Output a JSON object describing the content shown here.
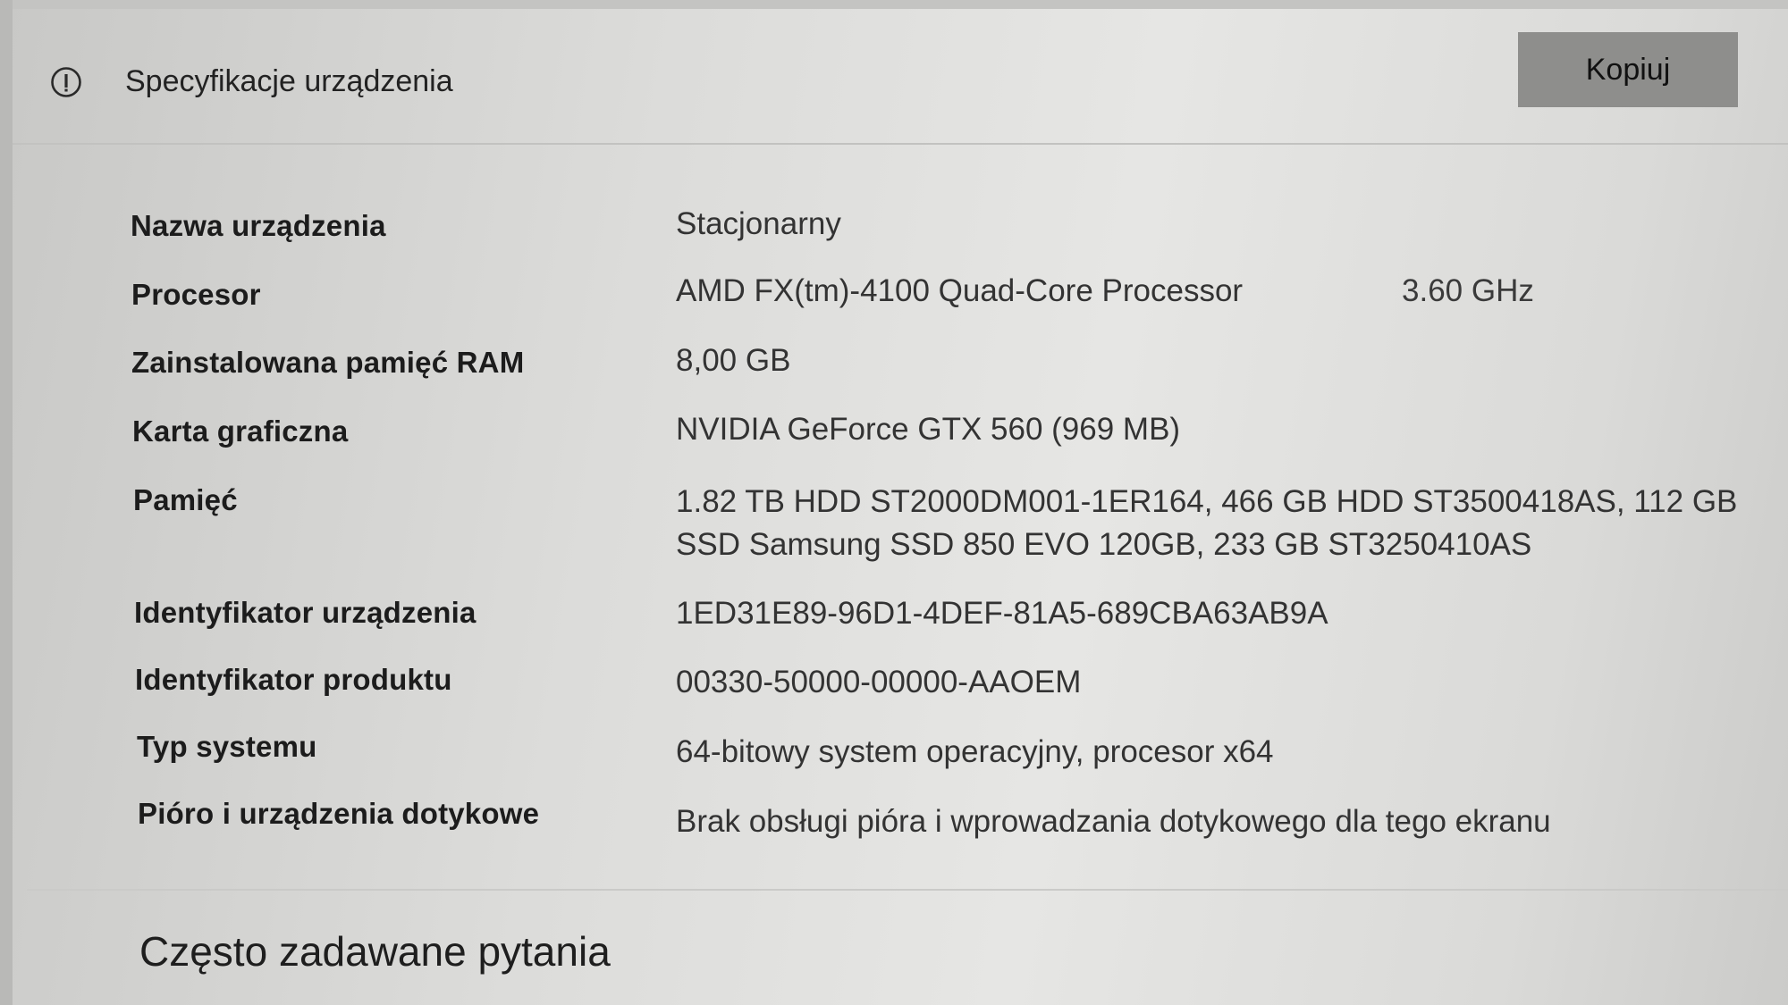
{
  "header": {
    "title": "Specyfikacje urządzenia",
    "copy_label": "Kopiuj",
    "icon": "info-icon"
  },
  "specs": [
    {
      "label": "Nazwa urządzenia",
      "value": "Stacjonarny"
    },
    {
      "label": "Procesor",
      "value": "AMD FX(tm)-4100 Quad-Core Processor",
      "extra": "3.60 GHz"
    },
    {
      "label": "Zainstalowana pamięć RAM",
      "value": "8,00 GB"
    },
    {
      "label": "Karta graficzna",
      "value": "NVIDIA GeForce GTX 560 (969 MB)"
    },
    {
      "label": "Pamięć",
      "value_line1": "1.82 TB HDD ST2000DM001-1ER164, 466 GB HDD ST3500418AS, 112 GB",
      "value_line2": "SSD Samsung SSD 850 EVO 120GB, 233 GB ST3250410AS"
    },
    {
      "label": "Identyfikator urządzenia",
      "value": "1ED31E89-96D1-4DEF-81A5-689CBA63AB9A"
    },
    {
      "label": "Identyfikator produktu",
      "value": "00330-50000-00000-AAOEM"
    },
    {
      "label": "Typ systemu",
      "value": "64-bitowy system operacyjny, procesor x64"
    },
    {
      "label": "Pióro i urządzenia dotykowe",
      "value": "Brak obsługi pióra i wprowadzania dotykowego dla tego ekranu"
    }
  ],
  "faq": {
    "title": "Często zadawane pytania"
  }
}
